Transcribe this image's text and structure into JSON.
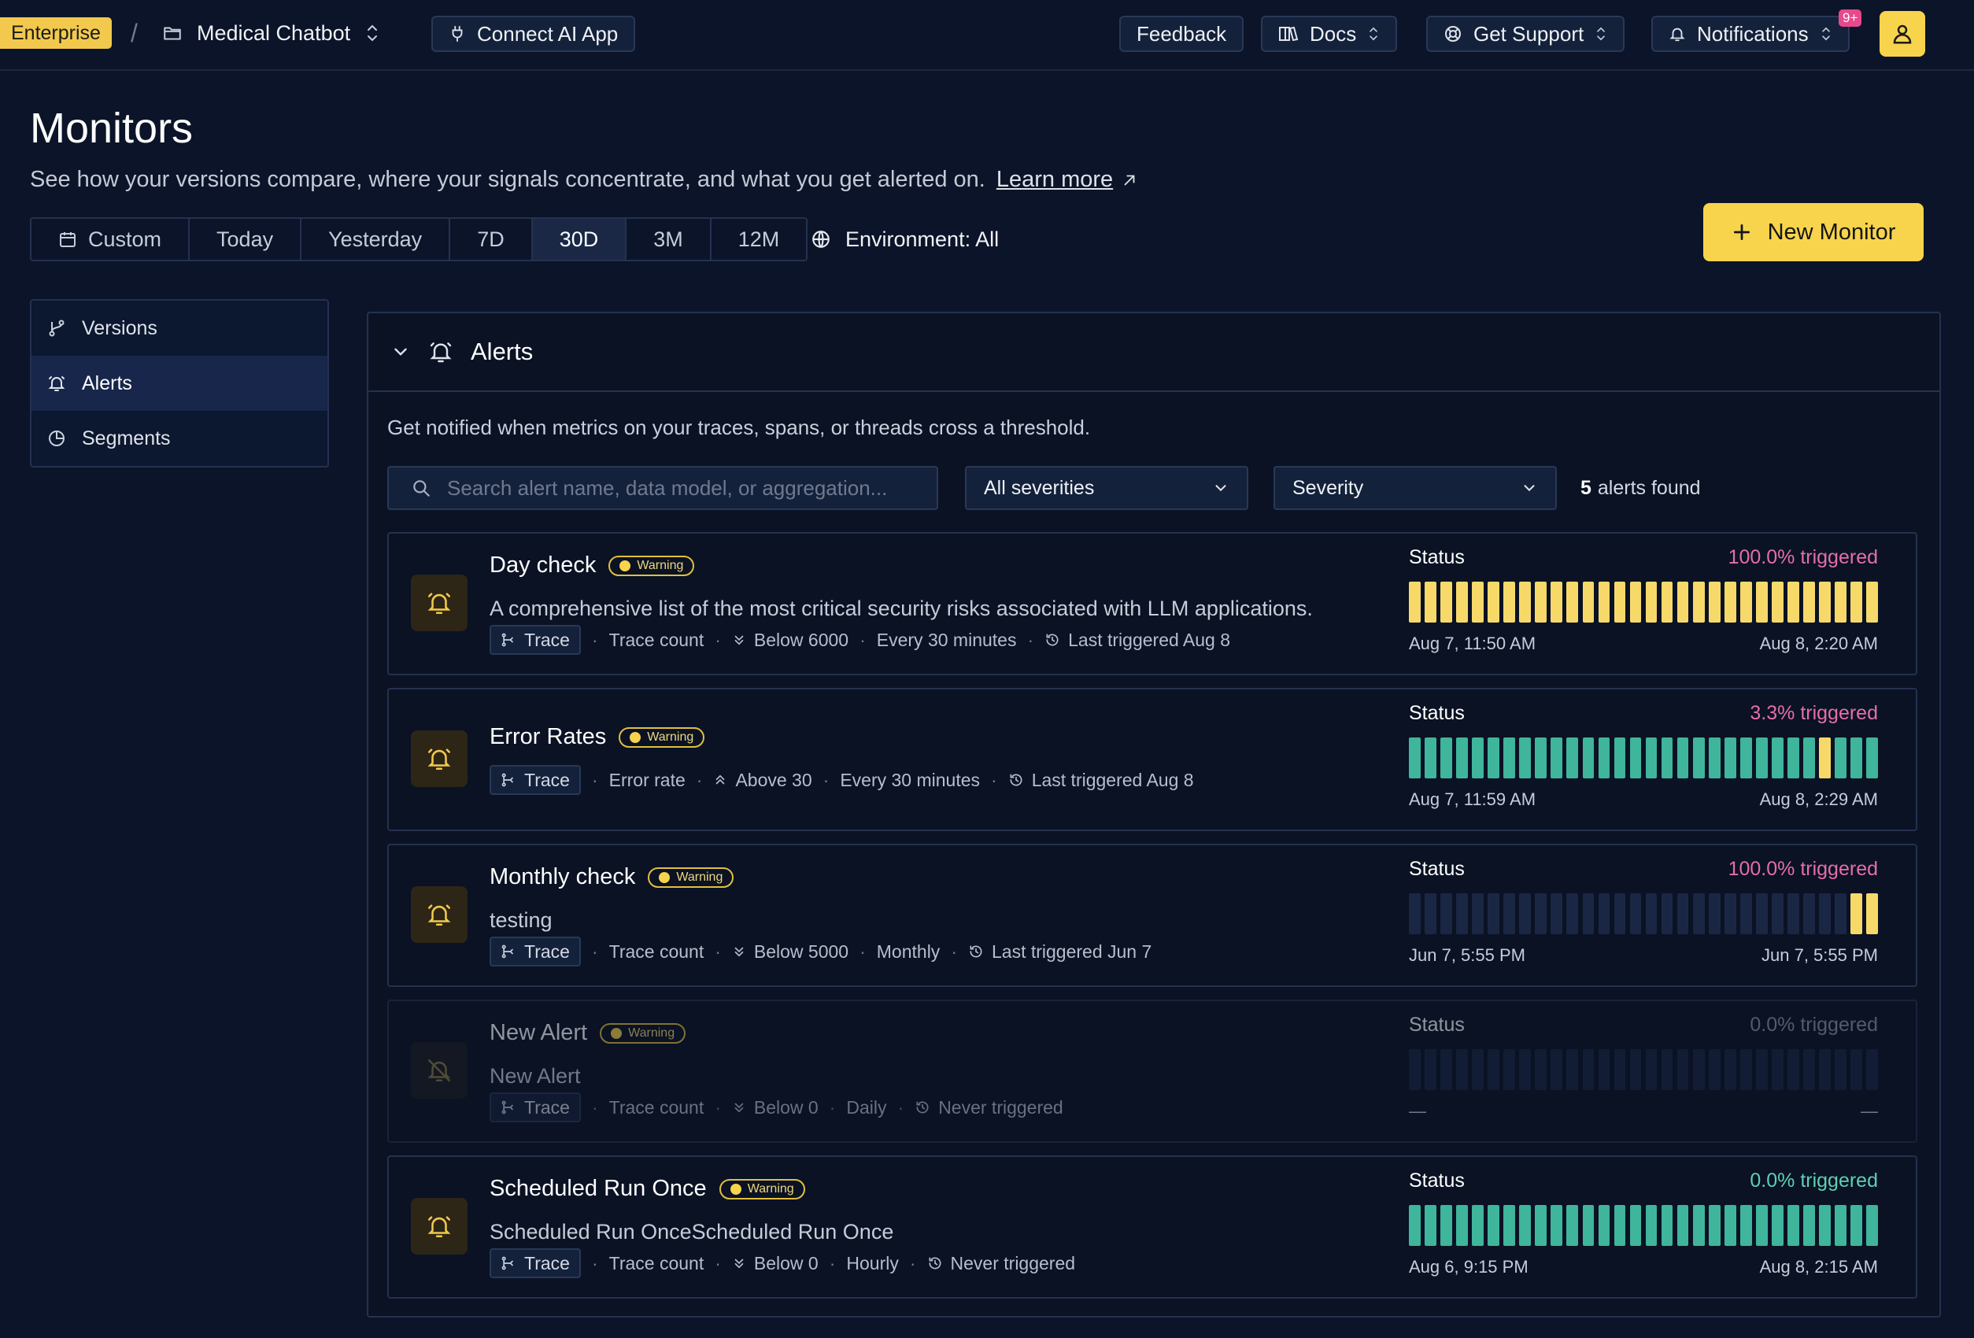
{
  "topbar": {
    "plan_badge": "Enterprise",
    "separator": "/",
    "project_name": "Medical Chatbot",
    "connect_label": "Connect AI App",
    "feedback_label": "Feedback",
    "docs_label": "Docs",
    "support_label": "Get Support",
    "notifications_label": "Notifications",
    "notifications_count": "9+"
  },
  "header": {
    "title": "Monitors",
    "subtitle": "See how your versions compare, where your signals concentrate, and what you get alerted on.",
    "learn_more": "Learn more",
    "ranges": [
      "Custom",
      "Today",
      "Yesterday",
      "7D",
      "30D",
      "3M",
      "12M"
    ],
    "active_range": "30D",
    "environment": "Environment: All",
    "new_monitor": "New Monitor"
  },
  "sidebar": {
    "items": [
      {
        "label": "Versions",
        "icon": "branch-icon"
      },
      {
        "label": "Alerts",
        "icon": "bell-icon"
      },
      {
        "label": "Segments",
        "icon": "pie-chart-icon"
      }
    ],
    "active": "Alerts"
  },
  "alerts_panel": {
    "title": "Alerts",
    "description": "Get notified when metrics on your traces, spans, or threads cross a threshold.",
    "search_placeholder": "Search alert name, data model, or aggregation...",
    "severity_filter": "All severities",
    "sort_select": "Severity",
    "found_count": "5",
    "found_text": "alerts found",
    "status_label": "Status",
    "alerts": [
      {
        "name": "Day check",
        "severity": "Warning",
        "description": "A comprehensive list of the most critical security risks associated with LLM applications.",
        "data_model": "Trace",
        "metric": "Trace count",
        "direction": "down",
        "threshold": "Below 6000",
        "frequency": "Every 30 minutes",
        "last_triggered": "Last triggered Aug 8",
        "triggered": "100.0% triggered",
        "trigger_color": "pink",
        "start": "Aug 7, 11:50 AM",
        "end": "Aug 8, 2:20 AM",
        "bars": [
          "y",
          "y",
          "y",
          "y",
          "y",
          "y",
          "y",
          "y",
          "y",
          "y",
          "y",
          "y",
          "y",
          "y",
          "y",
          "y",
          "y",
          "y",
          "y",
          "y",
          "y",
          "y",
          "y",
          "y",
          "y",
          "y",
          "y",
          "y",
          "y",
          "y"
        ],
        "enabled": true
      },
      {
        "name": "Error Rates",
        "severity": "Warning",
        "description": "",
        "data_model": "Trace",
        "metric": "Error rate",
        "direction": "up",
        "threshold": "Above 30",
        "frequency": "Every 30 minutes",
        "last_triggered": "Last triggered Aug 8",
        "triggered": "3.3% triggered",
        "trigger_color": "pink",
        "start": "Aug 7, 11:59 AM",
        "end": "Aug 8, 2:29 AM",
        "bars": [
          "g",
          "g",
          "g",
          "g",
          "g",
          "g",
          "g",
          "g",
          "g",
          "g",
          "g",
          "g",
          "g",
          "g",
          "g",
          "g",
          "g",
          "g",
          "g",
          "g",
          "g",
          "g",
          "g",
          "g",
          "g",
          "g",
          "y",
          "g",
          "g",
          "g"
        ],
        "enabled": true
      },
      {
        "name": "Monthly check",
        "severity": "Warning",
        "description": "testing",
        "data_model": "Trace",
        "metric": "Trace count",
        "direction": "down",
        "threshold": "Below 5000",
        "frequency": "Monthly",
        "last_triggered": "Last triggered Jun 7",
        "triggered": "100.0% triggered",
        "trigger_color": "pink",
        "start": "Jun 7, 5:55 PM",
        "end": "Jun 7, 5:55 PM",
        "bars": [
          "e",
          "e",
          "e",
          "e",
          "e",
          "e",
          "e",
          "e",
          "e",
          "e",
          "e",
          "e",
          "e",
          "e",
          "e",
          "e",
          "e",
          "e",
          "e",
          "e",
          "e",
          "e",
          "e",
          "e",
          "e",
          "e",
          "e",
          "e",
          "y",
          "y"
        ],
        "enabled": true
      },
      {
        "name": "New Alert",
        "severity": "Warning",
        "description": "New Alert",
        "data_model": "Trace",
        "metric": "Trace count",
        "direction": "down",
        "threshold": "Below 0",
        "frequency": "Daily",
        "last_triggered": "Never triggered",
        "triggered": "0.0% triggered",
        "trigger_color": "gray",
        "start": "—",
        "end": "—",
        "bars": [
          "e",
          "e",
          "e",
          "e",
          "e",
          "e",
          "e",
          "e",
          "e",
          "e",
          "e",
          "e",
          "e",
          "e",
          "e",
          "e",
          "e",
          "e",
          "e",
          "e",
          "e",
          "e",
          "e",
          "e",
          "e",
          "e",
          "e",
          "e",
          "e",
          "e"
        ],
        "enabled": false
      },
      {
        "name": "Scheduled Run Once",
        "severity": "Warning",
        "description": "Scheduled Run OnceScheduled Run Once",
        "data_model": "Trace",
        "metric": "Trace count",
        "direction": "down",
        "threshold": "Below 0",
        "frequency": "Hourly",
        "last_triggered": "Never triggered",
        "triggered": "0.0% triggered",
        "trigger_color": "teal",
        "start": "Aug 6, 9:15 PM",
        "end": "Aug 8, 2:15 AM",
        "bars": [
          "g",
          "g",
          "g",
          "g",
          "g",
          "g",
          "g",
          "g",
          "g",
          "g",
          "g",
          "g",
          "g",
          "g",
          "g",
          "g",
          "g",
          "g",
          "g",
          "g",
          "g",
          "g",
          "g",
          "g",
          "g",
          "g",
          "g",
          "g",
          "g",
          "g"
        ],
        "enabled": true
      }
    ]
  },
  "colors": {
    "accent": "#f7d44c",
    "background": "#0b1428",
    "triggered_pink": "#e56ea8",
    "ok_green": "#3fb59b",
    "bar_yellow": "#f7d96a"
  }
}
